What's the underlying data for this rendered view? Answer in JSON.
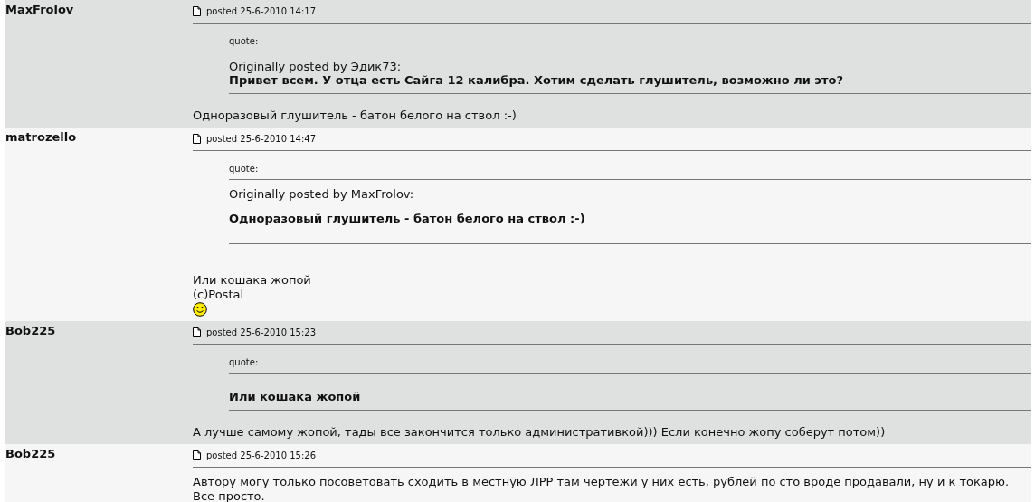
{
  "posts": [
    {
      "author": "MaxFrolov",
      "posted": "posted 25-6-2010 14:17",
      "quote": {
        "label": "quote:",
        "attribution": "Originally posted by Эдик73:",
        "text": "Привет всем. У отца есть Сайга 12 калибра. Хотим сделать глушитель, возможно ли это?",
        "separated": false
      },
      "body": [
        {
          "kind": "text",
          "text": "Одноразовый глушитель - батон белого на ствол :-)"
        }
      ]
    },
    {
      "author": "matrozello",
      "posted": "posted 25-6-2010 14:47",
      "quote": {
        "label": "quote:",
        "attribution": "Originally posted by MaxFrolov:",
        "text": "Одноразовый глушитель - батон белого на ствол :-)",
        "separated": true
      },
      "body": [
        {
          "kind": "text",
          "text": "Или кошака жопой"
        },
        {
          "kind": "text",
          "text": "(c)Postal"
        },
        {
          "kind": "smiley"
        }
      ]
    },
    {
      "author": "Bob225",
      "posted": "posted 25-6-2010 15:23",
      "quote": {
        "label": "quote:",
        "text": "Или кошака жопой",
        "separated": false
      },
      "body": [
        {
          "kind": "text",
          "text": "А лучше самому жопой, тады все закончится только административкой))) Если конечно жопу соберут потом))"
        }
      ]
    },
    {
      "author": "Bob225",
      "posted": "posted 25-6-2010 15:26",
      "body": [
        {
          "kind": "text",
          "text": "Автору могу только посоветовать сходить в местную ЛРР там чертежи у них есть, рублей по сто вроде продавали, ну и к токарю."
        },
        {
          "kind": "text",
          "text": "Все просто."
        }
      ]
    }
  ]
}
